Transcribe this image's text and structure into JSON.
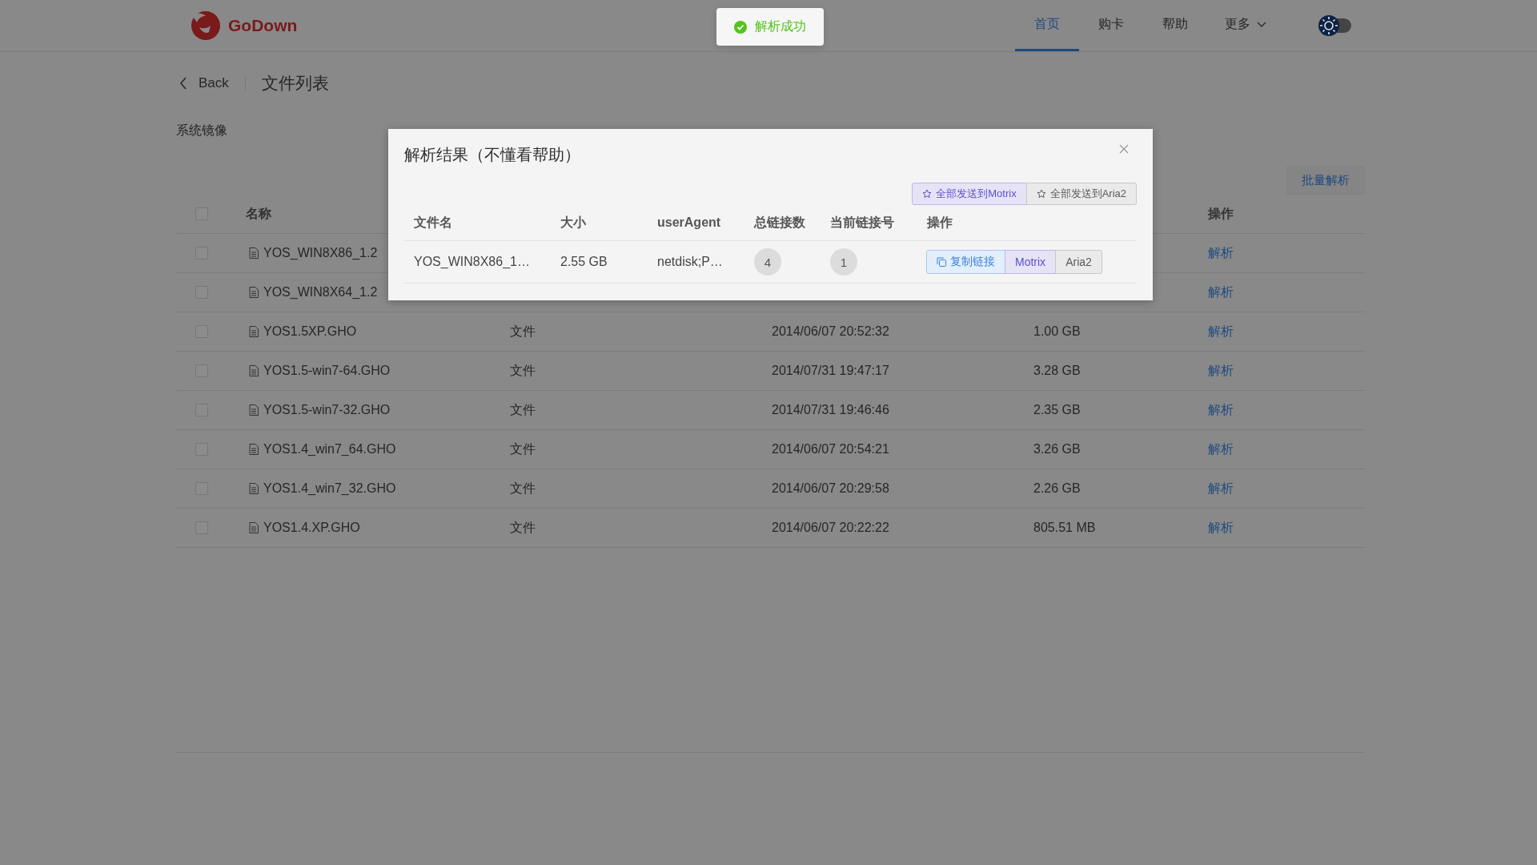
{
  "header": {
    "logo": "GoDown",
    "nav": [
      {
        "label": "首页",
        "selected": true,
        "dropdown": false
      },
      {
        "label": "购卡",
        "selected": false,
        "dropdown": false
      },
      {
        "label": "帮助",
        "selected": false,
        "dropdown": false
      },
      {
        "label": "更多",
        "selected": false,
        "dropdown": true
      }
    ]
  },
  "toast": {
    "text": "解析成功"
  },
  "page": {
    "back": "Back",
    "title": "文件列表",
    "folder": "系统镜像",
    "batch_button": "批量解析"
  },
  "table": {
    "select_all": {
      "checked": false
    },
    "columns": {
      "name": "名称",
      "actions": "操作"
    },
    "rows": [
      {
        "checked": false,
        "name": "YOS_WIN8X86_1.2",
        "action": "解析"
      },
      {
        "checked": false,
        "name": "YOS_WIN8X64_1.2",
        "action": "解析"
      },
      {
        "checked": false,
        "name": "YOS1.5XP.GHO",
        "type": "文件",
        "created": "2014/06/07 20:52:32",
        "size": "1.00 GB",
        "action": "解析"
      },
      {
        "checked": false,
        "name": "YOS1.5-win7-64.GHO",
        "type": "文件",
        "created": "2014/07/31 19:47:17",
        "size": "3.28 GB",
        "action": "解析"
      },
      {
        "checked": false,
        "name": "YOS1.5-win7-32.GHO",
        "type": "文件",
        "created": "2014/07/31 19:46:46",
        "size": "2.35 GB",
        "action": "解析"
      },
      {
        "checked": false,
        "name": "YOS1.4_win7_64.GHO",
        "type": "文件",
        "created": "2014/06/07 20:54:21",
        "size": "3.26 GB",
        "action": "解析"
      },
      {
        "checked": false,
        "name": "YOS1.4_win7_32.GHO",
        "type": "文件",
        "created": "2014/06/07 20:29:58",
        "size": "2.26 GB",
        "action": "解析"
      },
      {
        "checked": false,
        "name": "YOS1.4.XP.GHO",
        "type": "文件",
        "created": "2014/06/07 20:22:22",
        "size": "805.51 MB",
        "action": "解析"
      }
    ]
  },
  "dialog": {
    "title": "解析结果（不懂看帮助）",
    "send_buttons": [
      {
        "label": "全部发送到Motrix",
        "kind": "motrix"
      },
      {
        "label": "全部发送到Aria2",
        "kind": "aria2"
      }
    ],
    "columns": [
      "文件名",
      "大小",
      "userAgent",
      "总链接数",
      "当前链接号",
      "操作"
    ],
    "rows": [
      {
        "file": "YOS_WIN8X86_1…",
        "size": "2.55 GB",
        "user_agent": "netdisk;P…",
        "total_links": "4",
        "current_link": "1",
        "actions": [
          {
            "label": "复制链接",
            "kind": "copy"
          },
          {
            "label": "Motrix",
            "kind": "motrix"
          },
          {
            "label": "Aria2",
            "kind": "aria2"
          }
        ]
      }
    ]
  }
}
